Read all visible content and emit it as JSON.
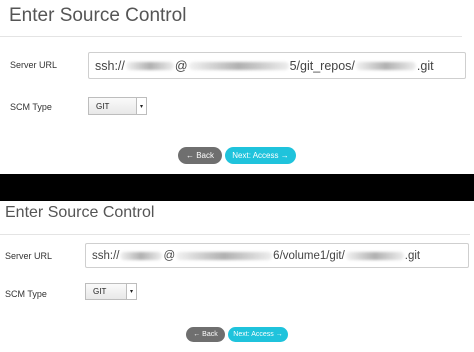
{
  "top": {
    "title": "Enter Source Control",
    "server_url_label": "Server URL",
    "url_prefix": "ssh://",
    "url_at": "@",
    "url_port_suffix": "5/git_repos/",
    "url_ext": ".git",
    "scm_type_label": "SCM Type",
    "scm_value": "GIT",
    "select_arrow": "▾",
    "back_label": "← Back",
    "next_label": "Next: Access →"
  },
  "bottom": {
    "title": "Enter Source Control",
    "server_url_label": "Server URL",
    "url_prefix": "ssh://",
    "url_at": "@",
    "url_port_suffix": "6/volume1/git/",
    "url_ext": ".git",
    "scm_type_label": "SCM Type",
    "scm_value": "GIT",
    "select_arrow": "▾",
    "back_label": "← Back",
    "next_label": "Next: Access →"
  },
  "colors": {
    "next_button": "#1fc3dc",
    "back_button": "#6f6f6f",
    "divider_band": "#000000"
  }
}
